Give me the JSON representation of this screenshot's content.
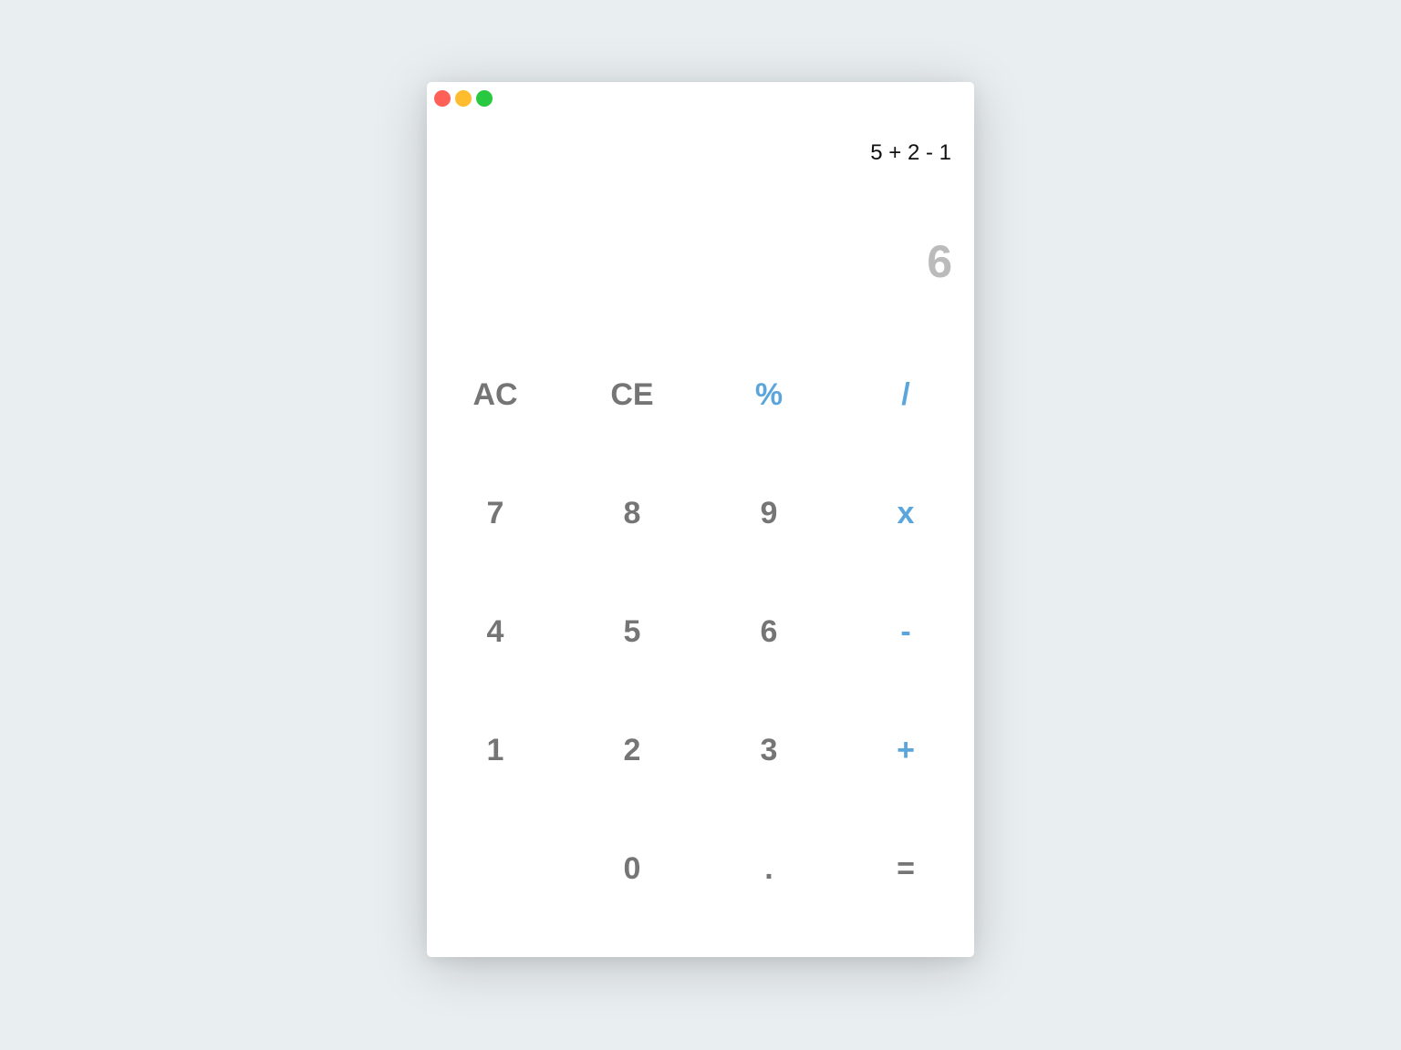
{
  "window": {
    "controls": [
      {
        "name": "close",
        "color": "#fe5f57"
      },
      {
        "name": "minimize",
        "color": "#febc2e"
      },
      {
        "name": "maximize",
        "color": "#28c840"
      }
    ]
  },
  "display": {
    "expression": "5 + 2 - 1",
    "result": "6"
  },
  "keypad": {
    "rows": [
      [
        {
          "label": "AC",
          "kind": "function"
        },
        {
          "label": "CE",
          "kind": "function"
        },
        {
          "label": "%",
          "kind": "operator"
        },
        {
          "label": "/",
          "kind": "operator"
        }
      ],
      [
        {
          "label": "7",
          "kind": "digit"
        },
        {
          "label": "8",
          "kind": "digit"
        },
        {
          "label": "9",
          "kind": "digit"
        },
        {
          "label": "x",
          "kind": "operator"
        }
      ],
      [
        {
          "label": "4",
          "kind": "digit"
        },
        {
          "label": "5",
          "kind": "digit"
        },
        {
          "label": "6",
          "kind": "digit"
        },
        {
          "label": "-",
          "kind": "operator"
        }
      ],
      [
        {
          "label": "1",
          "kind": "digit"
        },
        {
          "label": "2",
          "kind": "digit"
        },
        {
          "label": "3",
          "kind": "digit"
        },
        {
          "label": "+",
          "kind": "operator"
        }
      ],
      [
        {
          "label": "",
          "kind": "empty"
        },
        {
          "label": "0",
          "kind": "digit"
        },
        {
          "label": ".",
          "kind": "digit"
        },
        {
          "label": "=",
          "kind": "equals"
        }
      ]
    ]
  },
  "colors": {
    "digit": "#757575",
    "operator": "#5aa6dc",
    "result": "#bbbbbb",
    "background": "#e9eef1"
  }
}
